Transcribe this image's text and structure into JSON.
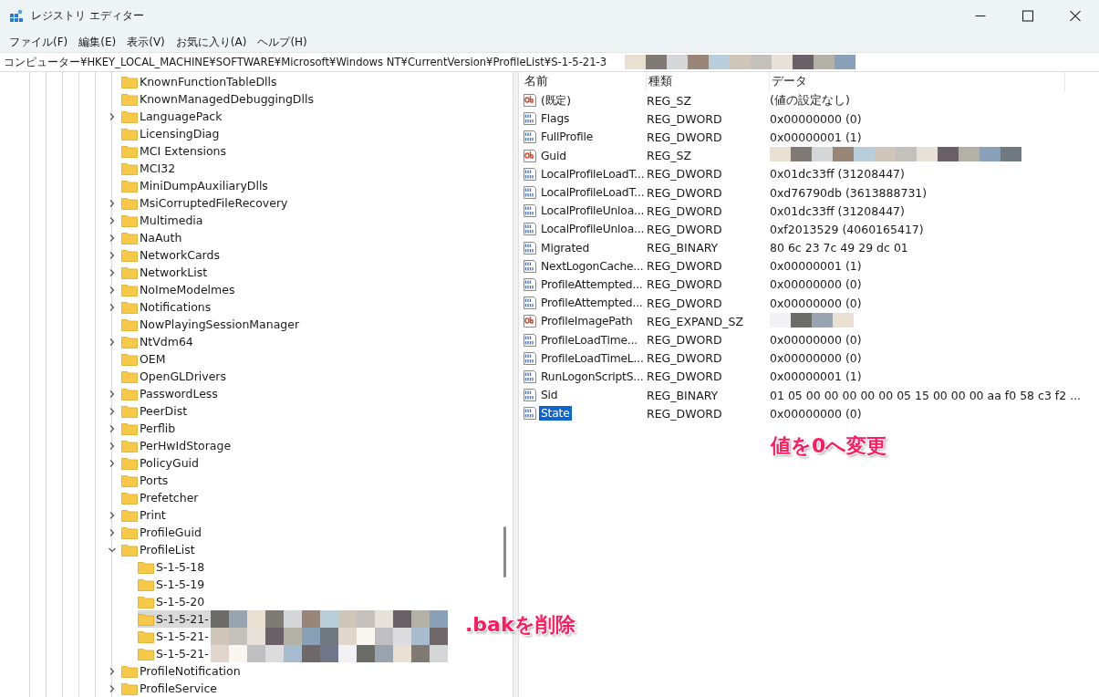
{
  "window": {
    "title": "レジストリ エディター"
  },
  "menu": [
    "ファイル(F)",
    "編集(E)",
    "表示(V)",
    "お気に入り(A)",
    "ヘルプ(H)"
  ],
  "address": {
    "path": "コンピューター¥HKEY_LOCAL_MACHINE¥SOFTWARE¥Microsoft¥Windows NT¥CurrentVersion¥ProfileList¥S-1-5-21-3",
    "redacted": true
  },
  "tree": [
    {
      "name": "KnownFunctionTableDlls",
      "expandable": false,
      "selected": false,
      "redacted": false
    },
    {
      "name": "KnownManagedDebuggingDlls",
      "expandable": false,
      "selected": false,
      "redacted": false
    },
    {
      "name": "LanguagePack",
      "expandable": true,
      "expanded": false,
      "selected": false,
      "redacted": false
    },
    {
      "name": "LicensingDiag",
      "expandable": false,
      "selected": false,
      "redacted": false
    },
    {
      "name": "MCI Extensions",
      "expandable": false,
      "selected": false,
      "redacted": false
    },
    {
      "name": "MCI32",
      "expandable": false,
      "selected": false,
      "redacted": false
    },
    {
      "name": "MiniDumpAuxiliaryDlls",
      "expandable": false,
      "selected": false,
      "redacted": false
    },
    {
      "name": "MsiCorruptedFileRecovery",
      "expandable": true,
      "expanded": false,
      "selected": false,
      "redacted": false
    },
    {
      "name": "Multimedia",
      "expandable": true,
      "expanded": false,
      "selected": false,
      "redacted": false
    },
    {
      "name": "NaAuth",
      "expandable": true,
      "expanded": false,
      "selected": false,
      "redacted": false
    },
    {
      "name": "NetworkCards",
      "expandable": true,
      "expanded": false,
      "selected": false,
      "redacted": false
    },
    {
      "name": "NetworkList",
      "expandable": true,
      "expanded": false,
      "selected": false,
      "redacted": false
    },
    {
      "name": "NoImeModelmes",
      "expandable": true,
      "expanded": false,
      "selected": false,
      "redacted": false
    },
    {
      "name": "Notifications",
      "expandable": true,
      "expanded": false,
      "selected": false,
      "redacted": false
    },
    {
      "name": "NowPlayingSessionManager",
      "expandable": false,
      "selected": false,
      "redacted": false
    },
    {
      "name": "NtVdm64",
      "expandable": true,
      "expanded": false,
      "selected": false,
      "redacted": false
    },
    {
      "name": "OEM",
      "expandable": false,
      "selected": false,
      "redacted": false
    },
    {
      "name": "OpenGLDrivers",
      "expandable": false,
      "selected": false,
      "redacted": false
    },
    {
      "name": "PasswordLess",
      "expandable": true,
      "expanded": false,
      "selected": false,
      "redacted": false
    },
    {
      "name": "PeerDist",
      "expandable": true,
      "expanded": false,
      "selected": false,
      "redacted": false
    },
    {
      "name": "Perflib",
      "expandable": true,
      "expanded": false,
      "selected": false,
      "redacted": false
    },
    {
      "name": "PerHwIdStorage",
      "expandable": true,
      "expanded": false,
      "selected": false,
      "redacted": false
    },
    {
      "name": "PolicyGuid",
      "expandable": true,
      "expanded": false,
      "selected": false,
      "redacted": false
    },
    {
      "name": "Ports",
      "expandable": false,
      "selected": false,
      "redacted": false
    },
    {
      "name": "Prefetcher",
      "expandable": false,
      "selected": false,
      "redacted": false
    },
    {
      "name": "Print",
      "expandable": true,
      "expanded": false,
      "selected": false,
      "redacted": false
    },
    {
      "name": "ProfileGuid",
      "expandable": true,
      "expanded": false,
      "selected": false,
      "redacted": false
    },
    {
      "name": "ProfileList",
      "expandable": true,
      "expanded": true,
      "selected": false,
      "redacted": false,
      "children": [
        {
          "name": "S-1-5-18",
          "expandable": false,
          "selected": false,
          "redacted": false
        },
        {
          "name": "S-1-5-19",
          "expandable": false,
          "selected": false,
          "redacted": false
        },
        {
          "name": "S-1-5-20",
          "expandable": false,
          "selected": false,
          "redacted": false
        },
        {
          "name": "S-1-5-21-",
          "expandable": false,
          "selected": true,
          "redacted": true
        },
        {
          "name": "S-1-5-21-",
          "expandable": false,
          "selected": false,
          "redacted": true
        },
        {
          "name": "S-1-5-21-",
          "expandable": false,
          "selected": false,
          "redacted": true
        }
      ]
    },
    {
      "name": "ProfileNotification",
      "expandable": true,
      "expanded": false,
      "selected": false,
      "redacted": false
    },
    {
      "name": "ProfileService",
      "expandable": true,
      "expanded": false,
      "selected": false,
      "redacted": false
    }
  ],
  "values": {
    "columns": [
      "名前",
      "種類",
      "データ"
    ],
    "rows": [
      {
        "kind": "string",
        "name": "(既定)",
        "type": "REG_SZ",
        "data": "(値の設定なし)",
        "redacted": false,
        "selected": false
      },
      {
        "kind": "binary",
        "name": "Flags",
        "type": "REG_DWORD",
        "data": "0x00000000 (0)",
        "redacted": false,
        "selected": false
      },
      {
        "kind": "binary",
        "name": "FullProfile",
        "type": "REG_DWORD",
        "data": "0x00000001 (1)",
        "redacted": false,
        "selected": false
      },
      {
        "kind": "string",
        "name": "Guid",
        "type": "REG_SZ",
        "redacted": true,
        "selected": false
      },
      {
        "kind": "binary",
        "name": "LocalProfileLoadT...",
        "type": "REG_DWORD",
        "data": "0x01dc33ff (31208447)",
        "redacted": false,
        "selected": false
      },
      {
        "kind": "binary",
        "name": "LocalProfileLoadT...",
        "type": "REG_DWORD",
        "data": "0xd76790db (3613888731)",
        "redacted": false,
        "selected": false
      },
      {
        "kind": "binary",
        "name": "LocalProfileUnloa...",
        "type": "REG_DWORD",
        "data": "0x01dc33ff (31208447)",
        "redacted": false,
        "selected": false
      },
      {
        "kind": "binary",
        "name": "LocalProfileUnloa...",
        "type": "REG_DWORD",
        "data": "0xf2013529 (4060165417)",
        "redacted": false,
        "selected": false
      },
      {
        "kind": "binary",
        "name": "Migrated",
        "type": "REG_BINARY",
        "data": "80 6c 23 7c 49 29 dc 01",
        "redacted": false,
        "selected": false
      },
      {
        "kind": "binary",
        "name": "NextLogonCache...",
        "type": "REG_DWORD",
        "data": "0x00000001 (1)",
        "redacted": false,
        "selected": false
      },
      {
        "kind": "binary",
        "name": "ProfileAttempted...",
        "type": "REG_DWORD",
        "data": "0x00000000 (0)",
        "redacted": false,
        "selected": false
      },
      {
        "kind": "binary",
        "name": "ProfileAttempted...",
        "type": "REG_DWORD",
        "data": "0x00000000 (0)",
        "redacted": false,
        "selected": false
      },
      {
        "kind": "string",
        "name": "ProfileImagePath",
        "type": "REG_EXPAND_SZ",
        "redacted": true,
        "selected": false
      },
      {
        "kind": "binary",
        "name": "ProfileLoadTime...",
        "type": "REG_DWORD",
        "data": "0x00000000 (0)",
        "redacted": false,
        "selected": false
      },
      {
        "kind": "binary",
        "name": "ProfileLoadTimeL...",
        "type": "REG_DWORD",
        "data": "0x00000000 (0)",
        "redacted": false,
        "selected": false
      },
      {
        "kind": "binary",
        "name": "RunLogonScriptS...",
        "type": "REG_DWORD",
        "data": "0x00000001 (1)",
        "redacted": false,
        "selected": false
      },
      {
        "kind": "binary",
        "name": "Sid",
        "type": "REG_BINARY",
        "data": "01 05 00 00 00 00 00 05 15 00 00 00 aa f0 58 c3 f2 ...",
        "redacted": false,
        "selected": false
      },
      {
        "kind": "binary",
        "name": "State",
        "type": "REG_DWORD",
        "data": "0x00000000 (0)",
        "redacted": false,
        "selected": true
      }
    ]
  },
  "annotations": [
    {
      "text": "値を0へ変更"
    },
    {
      "text": ".bakを削除"
    }
  ]
}
